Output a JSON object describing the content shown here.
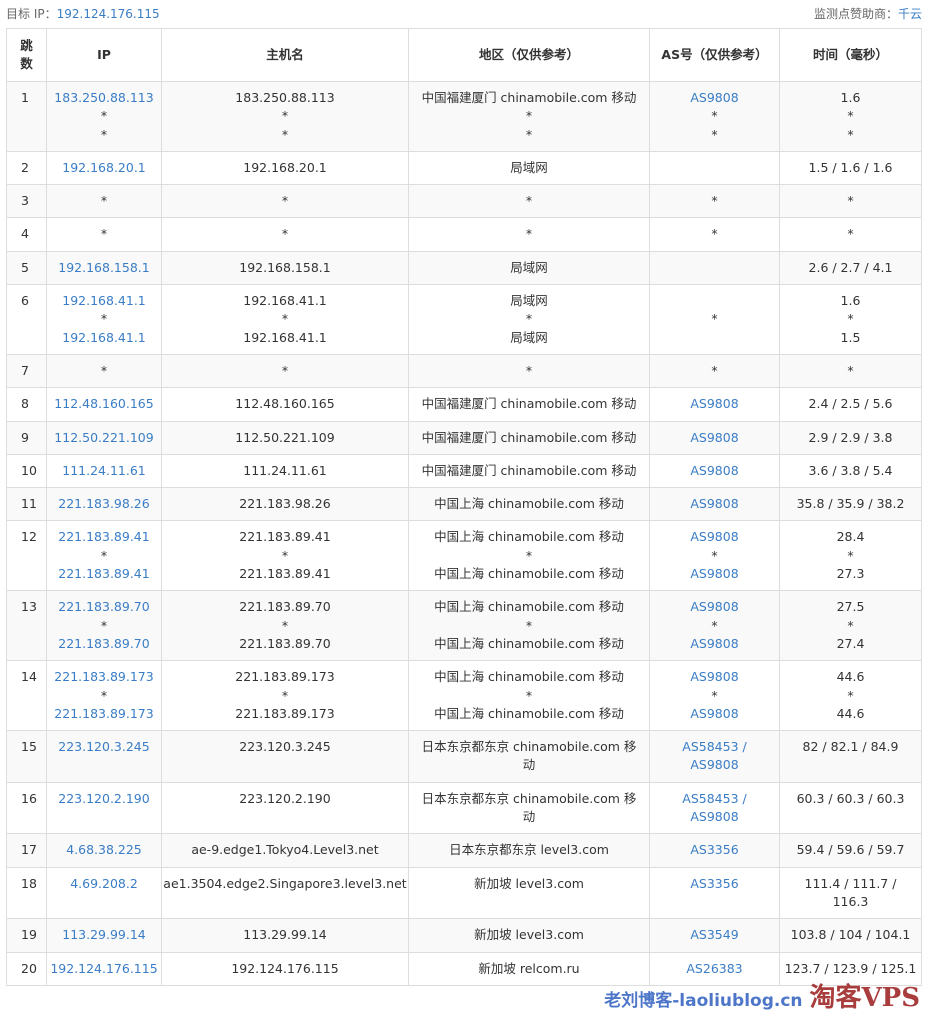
{
  "header": {
    "target_label": "目标 IP：",
    "target_ip": "192.124.176.115",
    "sponsor_label": "监测点赞助商：",
    "sponsor_name": "千云"
  },
  "columns": [
    "跳数",
    "IP",
    "主机名",
    "地区（仅供参考）",
    "AS号（仅供参考）",
    "时间（毫秒）"
  ],
  "rows": [
    {
      "hop": "1",
      "ip": [
        "183.250.88.113",
        "*",
        "*"
      ],
      "host": [
        "183.250.88.113",
        "*",
        "*"
      ],
      "region": [
        "中国福建厦门 chinamobile.com 移动",
        "*",
        "*"
      ],
      "as": [
        "AS9808",
        "*",
        "*"
      ],
      "time": [
        "1.6",
        "*",
        "*"
      ]
    },
    {
      "hop": "2",
      "ip": [
        "192.168.20.1"
      ],
      "host": [
        "192.168.20.1"
      ],
      "region": [
        "局域网"
      ],
      "as": [
        ""
      ],
      "time": [
        "1.5 / 1.6 / 1.6"
      ]
    },
    {
      "hop": "3",
      "ip": [
        "*"
      ],
      "host": [
        "*"
      ],
      "region": [
        "*"
      ],
      "as": [
        "*"
      ],
      "time": [
        "*"
      ]
    },
    {
      "hop": "4",
      "ip": [
        "*"
      ],
      "host": [
        "*"
      ],
      "region": [
        "*"
      ],
      "as": [
        "*"
      ],
      "time": [
        "*"
      ]
    },
    {
      "hop": "5",
      "ip": [
        "192.168.158.1"
      ],
      "host": [
        "192.168.158.1"
      ],
      "region": [
        "局域网"
      ],
      "as": [
        ""
      ],
      "time": [
        "2.6 / 2.7 / 4.1"
      ]
    },
    {
      "hop": "6",
      "ip": [
        "192.168.41.1",
        "*",
        "192.168.41.1"
      ],
      "host": [
        "192.168.41.1",
        "*",
        "192.168.41.1"
      ],
      "region": [
        "局域网",
        "*",
        "局域网"
      ],
      "as": [
        "",
        "*",
        ""
      ],
      "time": [
        "1.6",
        "*",
        "1.5"
      ]
    },
    {
      "hop": "7",
      "ip": [
        "*"
      ],
      "host": [
        "*"
      ],
      "region": [
        "*"
      ],
      "as": [
        "*"
      ],
      "time": [
        "*"
      ]
    },
    {
      "hop": "8",
      "ip": [
        "112.48.160.165"
      ],
      "host": [
        "112.48.160.165"
      ],
      "region": [
        "中国福建厦门 chinamobile.com 移动"
      ],
      "as": [
        "AS9808"
      ],
      "time": [
        "2.4 / 2.5 / 5.6"
      ]
    },
    {
      "hop": "9",
      "ip": [
        "112.50.221.109"
      ],
      "host": [
        "112.50.221.109"
      ],
      "region": [
        "中国福建厦门 chinamobile.com 移动"
      ],
      "as": [
        "AS9808"
      ],
      "time": [
        "2.9 / 2.9 / 3.8"
      ]
    },
    {
      "hop": "10",
      "ip": [
        "111.24.11.61"
      ],
      "host": [
        "111.24.11.61"
      ],
      "region": [
        "中国福建厦门 chinamobile.com 移动"
      ],
      "as": [
        "AS9808"
      ],
      "time": [
        "3.6 / 3.8 / 5.4"
      ]
    },
    {
      "hop": "11",
      "ip": [
        "221.183.98.26"
      ],
      "host": [
        "221.183.98.26"
      ],
      "region": [
        "中国上海 chinamobile.com 移动"
      ],
      "as": [
        "AS9808"
      ],
      "time": [
        "35.8 / 35.9 / 38.2"
      ]
    },
    {
      "hop": "12",
      "ip": [
        "221.183.89.41",
        "*",
        "221.183.89.41"
      ],
      "host": [
        "221.183.89.41",
        "*",
        "221.183.89.41"
      ],
      "region": [
        "中国上海 chinamobile.com 移动",
        "*",
        "中国上海 chinamobile.com 移动"
      ],
      "as": [
        "AS9808",
        "*",
        "AS9808"
      ],
      "time": [
        "28.4",
        "*",
        "27.3"
      ]
    },
    {
      "hop": "13",
      "ip": [
        "221.183.89.70",
        "*",
        "221.183.89.70"
      ],
      "host": [
        "221.183.89.70",
        "*",
        "221.183.89.70"
      ],
      "region": [
        "中国上海 chinamobile.com 移动",
        "*",
        "中国上海 chinamobile.com 移动"
      ],
      "as": [
        "AS9808",
        "*",
        "AS9808"
      ],
      "time": [
        "27.5",
        "*",
        "27.4"
      ]
    },
    {
      "hop": "14",
      "ip": [
        "221.183.89.173",
        "*",
        "221.183.89.173"
      ],
      "host": [
        "221.183.89.173",
        "*",
        "221.183.89.173"
      ],
      "region": [
        "中国上海 chinamobile.com 移动",
        "*",
        "中国上海 chinamobile.com 移动"
      ],
      "as": [
        "AS9808",
        "*",
        "AS9808"
      ],
      "time": [
        "44.6",
        "*",
        "44.6"
      ]
    },
    {
      "hop": "15",
      "ip": [
        "223.120.3.245"
      ],
      "host": [
        "223.120.3.245"
      ],
      "region": [
        "日本东京都东京 chinamobile.com 移动"
      ],
      "as": [
        "AS58453 / AS9808"
      ],
      "time": [
        "82 / 82.1 / 84.9"
      ]
    },
    {
      "hop": "16",
      "ip": [
        "223.120.2.190"
      ],
      "host": [
        "223.120.2.190"
      ],
      "region": [
        "日本东京都东京 chinamobile.com 移动"
      ],
      "as": [
        "AS58453 / AS9808"
      ],
      "time": [
        "60.3 / 60.3 / 60.3"
      ]
    },
    {
      "hop": "17",
      "ip": [
        "4.68.38.225"
      ],
      "host": [
        "ae-9.edge1.Tokyo4.Level3.net"
      ],
      "region": [
        "日本东京都东京 level3.com"
      ],
      "as": [
        "AS3356"
      ],
      "time": [
        "59.4 / 59.6 / 59.7"
      ]
    },
    {
      "hop": "18",
      "ip": [
        "4.69.208.2"
      ],
      "host": [
        "ae1.3504.edge2.Singapore3.level3.net"
      ],
      "region": [
        "新加坡 level3.com"
      ],
      "as": [
        "AS3356"
      ],
      "time": [
        "111.4 / 111.7 / 116.3"
      ]
    },
    {
      "hop": "19",
      "ip": [
        "113.29.99.14"
      ],
      "host": [
        "113.29.99.14"
      ],
      "region": [
        "新加坡 level3.com"
      ],
      "as": [
        "AS3549"
      ],
      "time": [
        "103.8 / 104 / 104.1"
      ]
    },
    {
      "hop": "20",
      "ip": [
        "192.124.176.115"
      ],
      "host": [
        "192.124.176.115"
      ],
      "region": [
        "新加坡 relcom.ru"
      ],
      "as": [
        "AS26383"
      ],
      "time": [
        "123.7 / 123.9 / 125.1"
      ]
    }
  ],
  "watermark": {
    "text1": "老刘博客-laoliublog.cn",
    "text2": "淘客VPS"
  },
  "colors": {
    "link": "#3a7dc6",
    "border": "#dddddd",
    "stripe": "#f9f9f9"
  }
}
